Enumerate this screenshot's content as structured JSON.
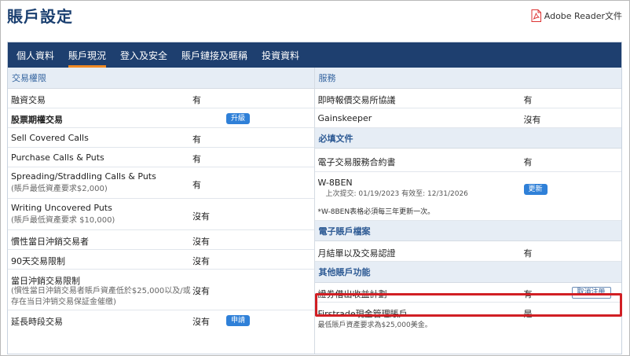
{
  "page": {
    "title": "賬戶設定",
    "adobe_label": "Adobe Reader文件"
  },
  "tabs": [
    {
      "label": "個人資料"
    },
    {
      "label": "賬戶現況"
    },
    {
      "label": "登入及安全"
    },
    {
      "label": "賬戶鏈接及暱稱"
    },
    {
      "label": "投資資料"
    }
  ],
  "left": {
    "header": "交易權限",
    "rows": [
      {
        "label": "融資交易",
        "value": "有"
      },
      {
        "label": "股票期權交易",
        "badge": "升級"
      },
      {
        "label": "Sell Covered Calls",
        "value": "有"
      },
      {
        "label": "Purchase Calls & Puts",
        "value": "有"
      },
      {
        "label": "Spreading/Straddling Calls & Puts",
        "sub": "(賬戶最低資產要求$2,000)",
        "value": "有"
      },
      {
        "label": "Writing Uncovered Puts",
        "sub": "(賬戶最低資產要求 $10,000)",
        "value": "沒有"
      },
      {
        "label": "慣性當日沖銷交易者",
        "value": "沒有"
      },
      {
        "label": "90天交易限制",
        "value": "沒有"
      },
      {
        "label": "當日沖銷交易限制",
        "sub1": "(慣性當日沖銷交易者賬戶資產低於$25,000以及/或",
        "sub2": "存在当日沖销交易保証金催缴)",
        "value": "沒有"
      },
      {
        "label": "延長時段交易",
        "value": "沒有",
        "badge": "申請"
      }
    ]
  },
  "right": {
    "services_header": "服務",
    "services": [
      {
        "label": "即時報價交易所協議",
        "value": "有"
      },
      {
        "label": "Gainskeeper",
        "value": "沒有"
      }
    ],
    "docs_header": "必填文件",
    "docs": [
      {
        "label": "電子交易服務合約書",
        "value": "有"
      },
      {
        "label": "W-8BEN",
        "sub": "上次提交: 01/19/2023  有效至: 12/31/2026",
        "badge": "更新"
      }
    ],
    "docs_note": "*W-8BEN表格必須每三年更新一次。",
    "edocs_header": "電子賬戶檔案",
    "edocs": [
      {
        "label": "月結單以及交易認證",
        "value": "有"
      }
    ],
    "other_header": "其他賬戶功能",
    "other": [
      {
        "label": "證券借出收益計劃",
        "value": "有",
        "button": "取消注册"
      },
      {
        "label": "Firstrade現金管理賬戶",
        "value": "是",
        "sub": "最低賬戶資產要求為$25,000美金。"
      }
    ]
  },
  "colors": {
    "nav": "#1e3f6f",
    "active_tab_underline": "#f08a24",
    "highlight": "#d11f24",
    "badge": "#2f80d8"
  }
}
